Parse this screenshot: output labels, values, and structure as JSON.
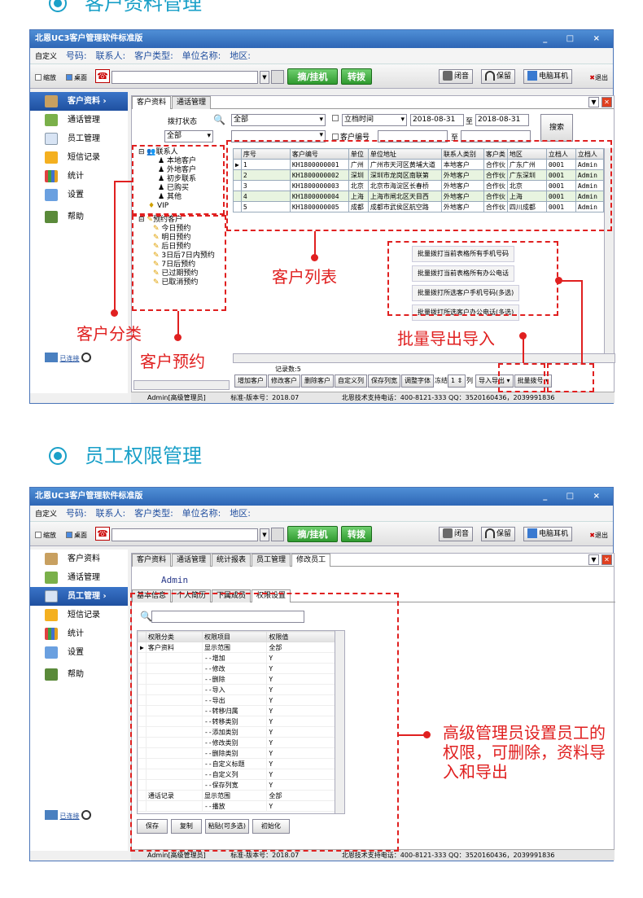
{
  "section1": {
    "title": "客户资料管理"
  },
  "section2": {
    "title": "员工权限管理"
  },
  "window": {
    "title": "北恩UC3客户管理软件标准版",
    "controls": "_ □ ×",
    "custom_label": "自定义",
    "info_labels": [
      "号码:",
      "联系人:",
      "客户类型:",
      "单位名称:",
      "地区:"
    ],
    "minimize_label": "缩放",
    "desktop_label": "桌面",
    "dial_label": "摘/挂机",
    "transfer_label": "转拨",
    "mute_label": "闭音",
    "hold_label": "保留",
    "headset_label": "电脑耳机",
    "exit_label": "退出",
    "status_user": "Admin[高级管理员]",
    "status_version": "标准-版本号：2018.07",
    "status_support": "北恩技术支持电话：400-8121-333  QQ：3520160436，2039991836",
    "connected_label": "已连接"
  },
  "sidebar": {
    "items": [
      {
        "label": "客户资料"
      },
      {
        "label": "通话管理"
      },
      {
        "label": "员工管理"
      },
      {
        "label": "短信记录"
      },
      {
        "label": "统计"
      },
      {
        "label": "设置"
      },
      {
        "label": "帮助"
      }
    ]
  },
  "screen1": {
    "tabs": [
      "客户资料",
      "通话管理"
    ],
    "filter": {
      "dial_status_label": "拨打状态",
      "all1": "全部",
      "all2": "全部",
      "date_field": "立档时间",
      "date_from": "2018-08-31",
      "to": "至",
      "date_to": "2018-08-31",
      "cust_no_label": "客户编号",
      "to2": "至",
      "search": "搜索"
    },
    "tree1": [
      "联系人",
      "本地客户",
      "外地客户",
      "初步联系",
      "已购买",
      "其他",
      "VIP"
    ],
    "tree2": [
      "预约客户",
      "今日预约",
      "明日预约",
      "后日预约",
      "3日后7日内预约",
      "7日后预约",
      "已过期预约",
      "已取消预约"
    ],
    "columns": [
      "序号",
      "客户编号",
      "单位",
      "单位地址",
      "联系人类别",
      "客户类",
      "地区",
      "立档人",
      "立档人"
    ],
    "rows": [
      [
        "1",
        "KH1800000001",
        "广州",
        "广州市天河区黄埔大道",
        "本地客户",
        "合作伙",
        "广东广州",
        "0001",
        "Admin"
      ],
      [
        "2",
        "KH1800000002",
        "深圳",
        "深圳市龙岗区南联第",
        "外地客户",
        "合作伙",
        "广东深圳",
        "0001",
        "Admin"
      ],
      [
        "3",
        "KH1800000003",
        "北京",
        "北京市海淀区长春桥",
        "外地客户",
        "合作伙",
        "北京",
        "0001",
        "Admin"
      ],
      [
        "4",
        "KH1800000004",
        "上海",
        "上海市闸北区天目西",
        "外地客户",
        "合作伙",
        "上海",
        "0001",
        "Admin"
      ],
      [
        "5",
        "KH1800000005",
        "成都",
        "成都市武侯区航空路",
        "外地客户",
        "合作伙",
        "四川成都",
        "0001",
        "Admin"
      ]
    ],
    "popup": [
      "批量拨打当前表格所有手机号码",
      "批量拨打当前表格所有办公电话",
      "批量拨打所选客户手机号码(多选)",
      "批量拨打所选客户办公电话(多选)"
    ],
    "records": "记录数:5",
    "buttons": [
      "增加客户",
      "修改客户",
      "删除客户",
      "自定义列",
      "保存列宽",
      "调整字体",
      "冻结",
      "1",
      "列",
      "导入导出 ▾",
      "批量拨号 ▾"
    ]
  },
  "annotations1": {
    "list": "客户列表",
    "category": "客户分类",
    "appointment": "客户预约",
    "batch": "批量导出导入"
  },
  "screen2": {
    "tabs": [
      "客户资料",
      "通话管理",
      "统计报表",
      "员工管理",
      "修改员工"
    ],
    "admin": "Admin",
    "subtabs": [
      "基本信息",
      "个人简历",
      "下属成员",
      "权限设置"
    ],
    "columns": [
      "权限分类",
      "权限项目",
      "权限值"
    ],
    "rows": [
      [
        "客户资料",
        "显示范围",
        "全部"
      ],
      [
        "",
        "--增加",
        "Y"
      ],
      [
        "",
        "--修改",
        "Y"
      ],
      [
        "",
        "--删除",
        "Y"
      ],
      [
        "",
        "--导入",
        "Y"
      ],
      [
        "",
        "--导出",
        "Y"
      ],
      [
        "",
        "--转移归属",
        "Y"
      ],
      [
        "",
        "--转移类别",
        "Y"
      ],
      [
        "",
        "--添加类别",
        "Y"
      ],
      [
        "",
        "--修改类别",
        "Y"
      ],
      [
        "",
        "--删除类别",
        "Y"
      ],
      [
        "",
        "--自定义标题",
        "Y"
      ],
      [
        "",
        "--自定义列",
        "Y"
      ],
      [
        "",
        "--保存列宽",
        "Y"
      ],
      [
        "通话记录",
        "显示范围",
        "全部"
      ],
      [
        "",
        "--播放",
        "Y"
      ]
    ],
    "buttons": [
      "保存",
      "复制",
      "粘贴(可多选)",
      "初始化"
    ]
  },
  "annotations2": {
    "note": "高级管理员设置员工的权限，可删除，资料导入和导出"
  }
}
